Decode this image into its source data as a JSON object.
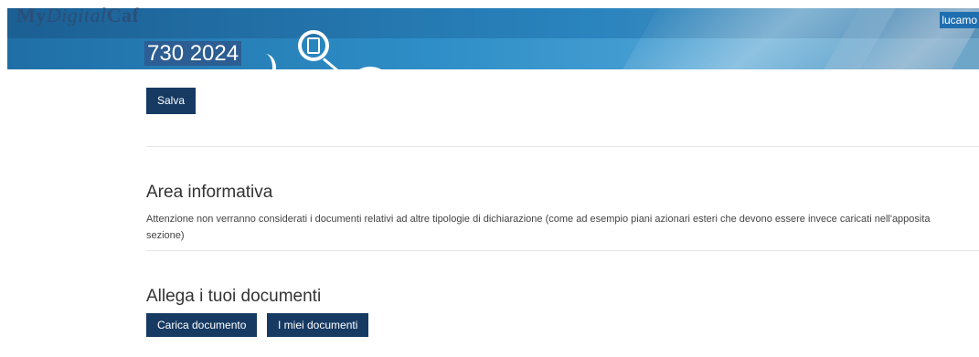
{
  "header": {
    "logo_prefix": "My",
    "logo_italic": "Digital",
    "logo_suffix": "Caf",
    "user": "lucamo",
    "page_title": "730 2024"
  },
  "toolbar": {
    "save_label": "Salva"
  },
  "info": {
    "title": "Area informativa",
    "text": "Attenzione non verranno considerati i documenti relativi ad altre tipologie di dichiarazione (come ad esempio piani azionari esteri che devono essere invece caricati nell'apposita sezione)"
  },
  "attach": {
    "title": "Allega i tuoi documenti",
    "upload_label": "Carica documento",
    "mydocs_label": "I miei documenti"
  }
}
